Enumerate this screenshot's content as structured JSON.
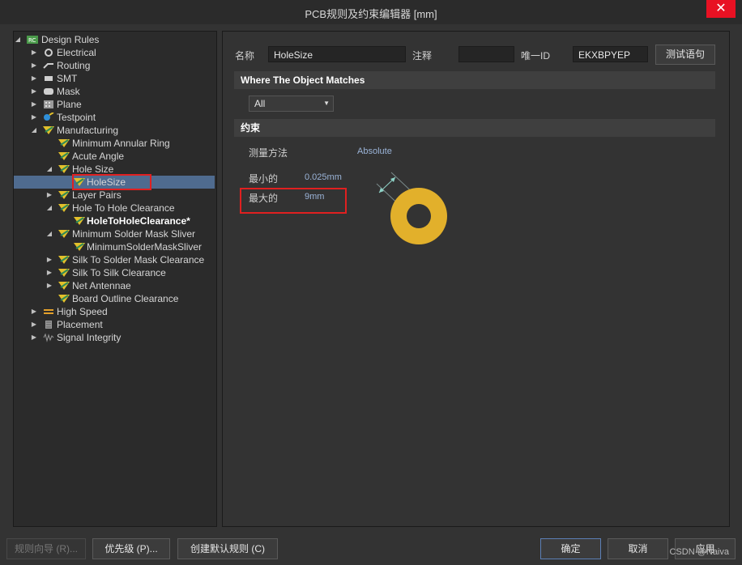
{
  "window": {
    "title": "PCB规则及约束编辑器 [mm]",
    "close_glyph": "✕"
  },
  "tree": {
    "items": [
      {
        "label": "Design Rules",
        "arrow": "◢",
        "icon": "design-rules-icon",
        "bold": false,
        "selected": false
      },
      {
        "label": "Electrical",
        "arrow": "▶",
        "icon": "electrical-icon",
        "bold": false,
        "selected": false
      },
      {
        "label": "Routing",
        "arrow": "▶",
        "icon": "routing-icon",
        "bold": false,
        "selected": false
      },
      {
        "label": "SMT",
        "arrow": "▶",
        "icon": "smt-icon",
        "bold": false,
        "selected": false
      },
      {
        "label": "Mask",
        "arrow": "▶",
        "icon": "mask-icon",
        "bold": false,
        "selected": false
      },
      {
        "label": "Plane",
        "arrow": "▶",
        "icon": "plane-icon",
        "bold": false,
        "selected": false
      },
      {
        "label": "Testpoint",
        "arrow": "▶",
        "icon": "testpoint-icon",
        "bold": false,
        "selected": false
      },
      {
        "label": "Manufacturing",
        "arrow": "◢",
        "icon": "rule-icon",
        "bold": false,
        "selected": false
      },
      {
        "label": "Minimum Annular Ring",
        "arrow": "",
        "icon": "rule-icon",
        "bold": false,
        "selected": false
      },
      {
        "label": "Acute Angle",
        "arrow": "",
        "icon": "rule-icon",
        "bold": false,
        "selected": false
      },
      {
        "label": "Hole Size",
        "arrow": "◢",
        "icon": "rule-icon",
        "bold": false,
        "selected": false
      },
      {
        "label": "HoleSize",
        "arrow": "",
        "icon": "rule-icon",
        "bold": false,
        "selected": true
      },
      {
        "label": "Layer Pairs",
        "arrow": "▶",
        "icon": "rule-icon",
        "bold": false,
        "selected": false
      },
      {
        "label": "Hole To Hole Clearance",
        "arrow": "◢",
        "icon": "rule-icon",
        "bold": false,
        "selected": false
      },
      {
        "label": "HoleToHoleClearance*",
        "arrow": "",
        "icon": "rule-icon",
        "bold": true,
        "selected": false
      },
      {
        "label": "Minimum Solder Mask Sliver",
        "arrow": "◢",
        "icon": "rule-icon",
        "bold": false,
        "selected": false
      },
      {
        "label": "MinimumSolderMaskSliver",
        "arrow": "",
        "icon": "rule-icon",
        "bold": false,
        "selected": false
      },
      {
        "label": "Silk To Solder Mask Clearance",
        "arrow": "▶",
        "icon": "rule-icon",
        "bold": false,
        "selected": false
      },
      {
        "label": "Silk To Silk Clearance",
        "arrow": "▶",
        "icon": "rule-icon",
        "bold": false,
        "selected": false
      },
      {
        "label": "Net Antennae",
        "arrow": "▶",
        "icon": "rule-icon",
        "bold": false,
        "selected": false
      },
      {
        "label": "Board Outline Clearance",
        "arrow": "",
        "icon": "rule-icon",
        "bold": false,
        "selected": false
      },
      {
        "label": "High Speed",
        "arrow": "▶",
        "icon": "high-speed-icon",
        "bold": false,
        "selected": false
      },
      {
        "label": "Placement",
        "arrow": "▶",
        "icon": "placement-icon",
        "bold": false,
        "selected": false
      },
      {
        "label": "Signal Integrity",
        "arrow": "▶",
        "icon": "signal-integrity-icon",
        "bold": false,
        "selected": false
      }
    ]
  },
  "rule": {
    "name_label": "名称",
    "name_value": "HoleSize",
    "comment_label": "注释",
    "comment_value": "",
    "uid_label": "唯一ID",
    "uid_value": "EKXBPYEP",
    "test_button": "测试语句"
  },
  "where": {
    "header": "Where The Object Matches",
    "dropdown_value": "All",
    "dropdown_caret": "▼"
  },
  "constraints": {
    "header": "约束",
    "method_label": "测量方法",
    "method_value": "Absolute",
    "min_label": "最小的",
    "min_value": "0.025mm",
    "max_label": "最大的",
    "max_value": "9mm"
  },
  "footer": {
    "wizard": "规则向导 (R)...",
    "priority": "优先级 (P)...",
    "create_default": "创建默认规则 (C)",
    "ok": "确定",
    "cancel": "取消",
    "apply": "应用"
  },
  "watermark": "CSDN @Naiva",
  "colors": {
    "ring": "#e2b02b",
    "selection": "#4f6b8f",
    "highlight_box": "#e02020",
    "close": "#e81123"
  }
}
